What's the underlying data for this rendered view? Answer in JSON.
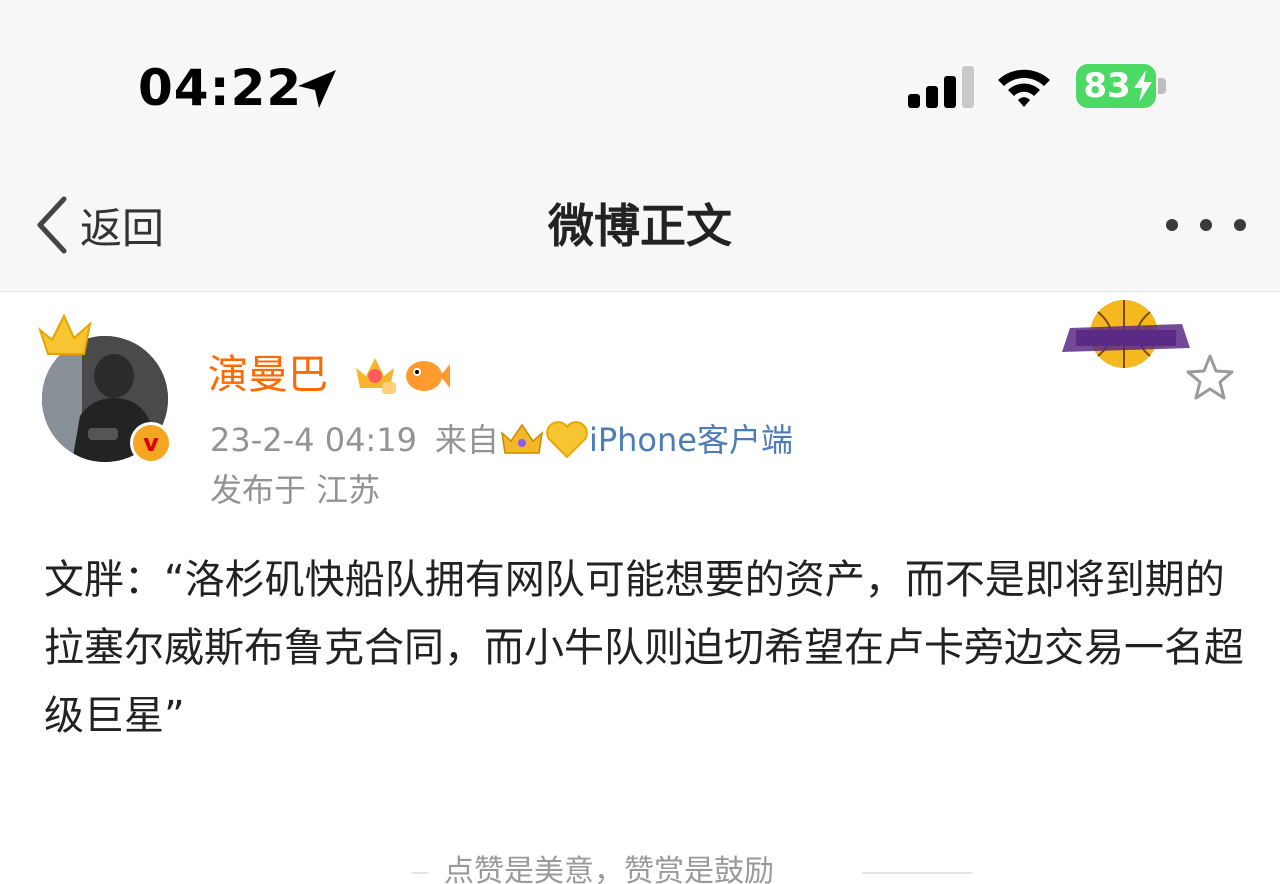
{
  "status_bar": {
    "time": "04:22",
    "battery": "83"
  },
  "nav": {
    "back_label": "返回",
    "title": "微博正文"
  },
  "post": {
    "username": "演曼巴",
    "date": "23-2-4 04:19",
    "from_label": "来自",
    "source": "iPhone客户端",
    "location": "发布于 江苏",
    "verified_mark": "v",
    "text": "文胖：“洛杉矶快船队拥有网队可能想要的资产，而不是即将到期的拉塞尔威斯布鲁克合同，而小牛队则迫切希望在卢卡旁边交易一名超级巨星”"
  },
  "footer": {
    "hint": "点赞是美意，赞赏是鼓励"
  },
  "colors": {
    "username": "#ff6a00",
    "link": "#4e7db5",
    "battery": "#4cd964",
    "meta": "#939393"
  },
  "icons": [
    "location-arrow-icon",
    "signal-icon",
    "wifi-icon",
    "battery-icon",
    "back-chevron-icon",
    "more-dots-icon",
    "crown-icon",
    "verified-badge-icon",
    "vip-crown-icon",
    "fish-icon",
    "heart-icon",
    "lakers-logo",
    "star-icon"
  ]
}
